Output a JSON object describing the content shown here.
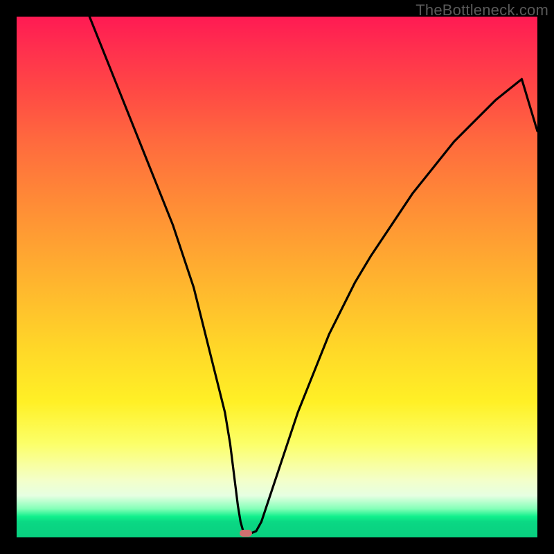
{
  "watermark": "TheBottleneck.com",
  "colors": {
    "frame": "#000000",
    "curve": "#000000",
    "marker": "#d07070"
  },
  "chart_data": {
    "type": "line",
    "title": "",
    "xlabel": "",
    "ylabel": "",
    "xlim": [
      0,
      100
    ],
    "ylim": [
      0,
      100
    ],
    "grid": false,
    "legend": false,
    "series": [
      {
        "name": "bottleneck-curve",
        "x": [
          14,
          16,
          18,
          20,
          22,
          24,
          26,
          28,
          30,
          32,
          34,
          35,
          36,
          37,
          38,
          39,
          40,
          41,
          41.5,
          42,
          42.5,
          43,
          43.5,
          44,
          44.5,
          45,
          46,
          47,
          48,
          50,
          52,
          54,
          56,
          58,
          60,
          62,
          65,
          68,
          72,
          76,
          80,
          84,
          88,
          92,
          97,
          100
        ],
        "y": [
          100,
          95,
          90,
          85,
          80,
          75,
          70,
          65,
          60,
          54,
          48,
          44,
          40,
          36,
          32,
          28,
          24,
          18,
          14,
          10,
          6,
          3,
          1.2,
          0.5,
          0.5,
          0.8,
          1.2,
          3,
          6,
          12,
          18,
          24,
          29,
          34,
          39,
          43,
          49,
          54,
          60,
          66,
          71,
          76,
          80,
          84,
          88,
          78
        ]
      }
    ],
    "annotations": [
      {
        "name": "minimum-marker",
        "x": 44,
        "y": 0.5
      }
    ]
  }
}
